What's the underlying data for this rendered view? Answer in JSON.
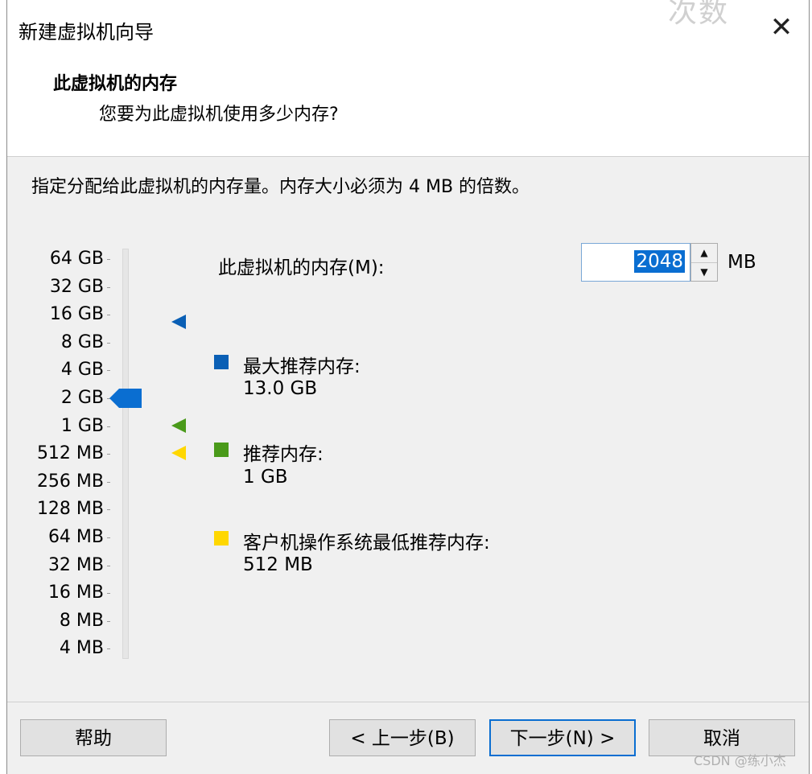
{
  "window": {
    "title": "新建虚拟机向导",
    "close_glyph": "✕"
  },
  "header": {
    "title": "此虚拟机的内存",
    "subtitle": "您要为此虚拟机使用多少内存?"
  },
  "instruction": "指定分配给此虚拟机的内存量。内存大小必须为 4 MB 的倍数。",
  "memory_scale": {
    "labels": [
      "64 GB",
      "32 GB",
      "16 GB",
      "8 GB",
      "4 GB",
      "2 GB",
      "1 GB",
      "512 MB",
      "256 MB",
      "128 MB",
      "64 MB",
      "32 MB",
      "16 MB",
      "8 MB",
      "4 MB"
    ],
    "selected": "2 GB"
  },
  "memory_input": {
    "label": "此虚拟机的内存(M):",
    "value": "2048",
    "unit": "MB",
    "spin_up": "▲",
    "spin_down": "▼"
  },
  "legend": [
    {
      "label": "最大推荐内存:",
      "value": "13.0 GB",
      "color": "#0a5fb5",
      "marker_at": "16 GB"
    },
    {
      "label": "推荐内存:",
      "value": "1 GB",
      "color": "#4a9a1a",
      "marker_at": "1 GB"
    },
    {
      "label": "客户机操作系统最低推荐内存:",
      "value": "512 MB",
      "color": "#ffd700",
      "marker_at": "512 MB"
    }
  ],
  "buttons": {
    "help": "帮助",
    "back": "< 上一步(B)",
    "next": "下一步(N) >",
    "cancel": "取消"
  },
  "watermark": "CSDN @练小杰",
  "corner_mark": "次数"
}
